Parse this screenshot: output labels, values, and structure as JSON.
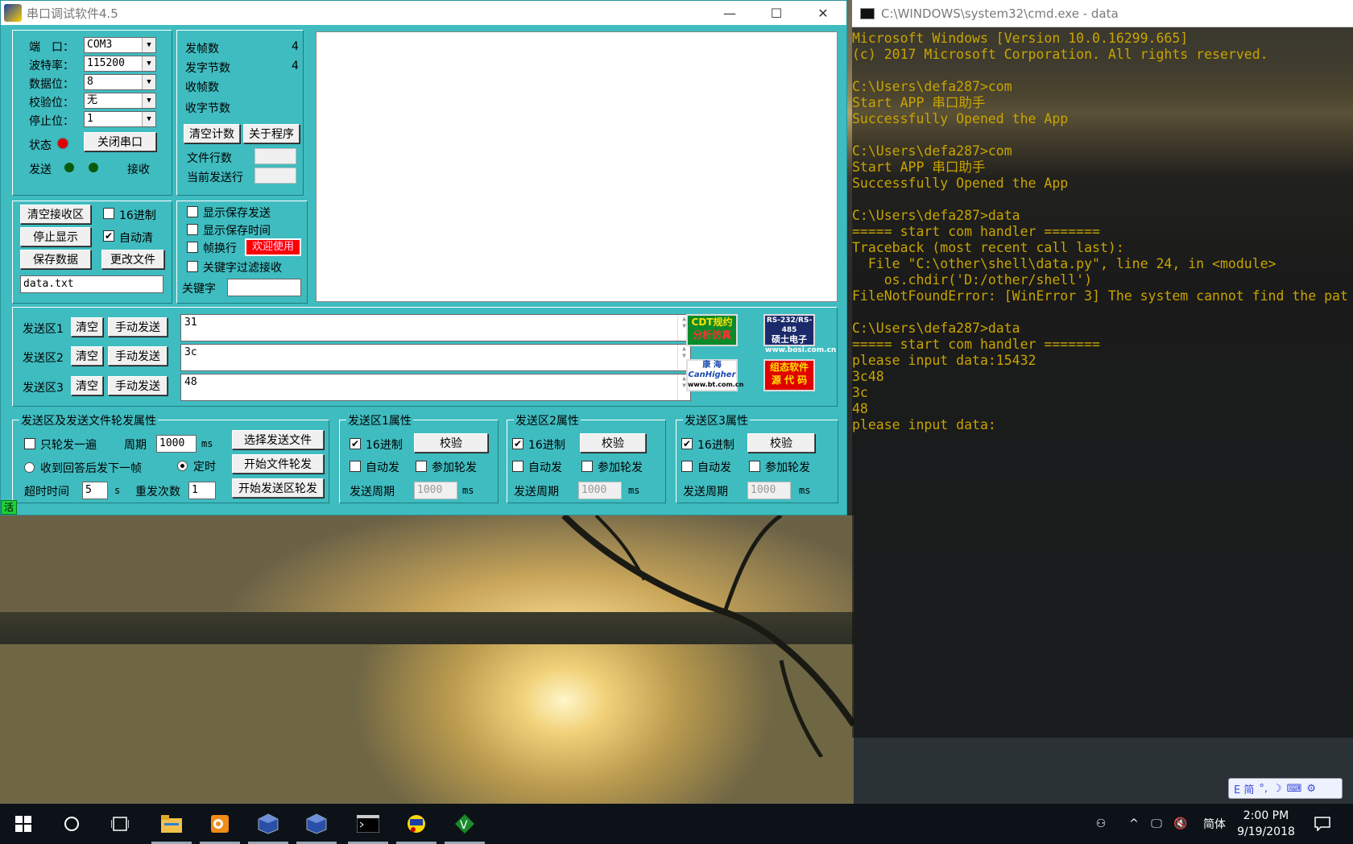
{
  "serial": {
    "title": "串口调试软件4.5",
    "port_labels": {
      "port": "端　口：",
      "baud": "波特率：",
      "databits": "数据位：",
      "parity": "校验位：",
      "stopbits": "停止位："
    },
    "port_values": {
      "port": "COM3",
      "baud": "115200",
      "databits": "8",
      "parity": "无",
      "stopbits": "1"
    },
    "status_label": "状态",
    "close_port_label": "关闭串口",
    "send_label": "发送",
    "recv_label": "接收",
    "counters": {
      "tx_frames_label": "发帧数",
      "tx_frames": "4",
      "tx_bytes_label": "发字节数",
      "tx_bytes": "4",
      "rx_frames_label": "收帧数",
      "rx_bytes_label": "收字节数"
    },
    "clear_count_label": "清空计数",
    "about_label": "关于程序",
    "file_lines_label": "文件行数",
    "current_line_label": "当前发送行",
    "rx_buttons": {
      "clear_rx": "清空接收区",
      "stop_display": "停止显示",
      "save_data": "保存数据",
      "change_file": "更改文件"
    },
    "hex16_label": "16进制",
    "auto_clear_label": "自动清",
    "filename": "data.txt",
    "options": {
      "show_save_send": "显示保存发送",
      "show_save_time": "显示保存时间",
      "frame_newline": "帧换行",
      "welcome": "欢迎使用",
      "keyword_filter": "关键字过滤接收",
      "keyword_label": "关键字"
    },
    "send_areas": [
      {
        "label": "发送区1",
        "clear": "清空",
        "manual": "手动发送",
        "value": "31"
      },
      {
        "label": "发送区2",
        "clear": "清空",
        "manual": "手动发送",
        "value": "3c"
      },
      {
        "label": "发送区3",
        "clear": "清空",
        "manual": "手动发送",
        "value": "48"
      }
    ],
    "logos": {
      "cdt_line1": "CDT规约",
      "cdt_line2": "分析仿真",
      "rs_line1": "RS-232/RS-485",
      "rs_line2": "硕士电子",
      "rs_line3": "www.bosi.com.cn",
      "kh_line1": "康 海",
      "kh_line2": "CanHigher",
      "kh_line3": "www.bt.com.cn",
      "zt_line1": "组态软件",
      "zt_line2": "源 代 码"
    },
    "rotation": {
      "group_title": "发送区及发送文件轮发属性",
      "once_label": "只轮发一遍",
      "period_label": "周期",
      "period_value": "1000",
      "ms": "ms",
      "on_reply_label": "收到回答后发下一帧",
      "timed_label": "定时",
      "timeout_label": "超时时间",
      "timeout_value": "5",
      "s": "s",
      "retry_label": "重发次数",
      "retry_value": "1",
      "select_file": "选择发送文件",
      "start_file_rotation": "开始文件轮发",
      "start_area_rotation": "开始发送区轮发"
    },
    "area_props": [
      {
        "title": "发送区1属性",
        "hex": "16进制",
        "verify": "校验",
        "auto": "自动发",
        "join": "参加轮发",
        "period_label": "发送周期",
        "period": "1000",
        "ms": "ms"
      },
      {
        "title": "发送区2属性",
        "hex": "16进制",
        "verify": "校验",
        "auto": "自动发",
        "join": "参加轮发",
        "period_label": "发送周期",
        "period": "1000",
        "ms": "ms"
      },
      {
        "title": "发送区3属性",
        "hex": "16进制",
        "verify": "校验",
        "auto": "自动发",
        "join": "参加轮发",
        "period_label": "发送周期",
        "period": "1000",
        "ms": "ms"
      }
    ],
    "active_tag": "活"
  },
  "cmd": {
    "title": "C:\\WINDOWS\\system32\\cmd.exe - data",
    "lines": [
      "Microsoft Windows [Version 10.0.16299.665]",
      "(c) 2017 Microsoft Corporation. All rights reserved.",
      "",
      "C:\\Users\\defa287>com",
      "Start APP 串口助手",
      "Successfully Opened the App",
      "",
      "C:\\Users\\defa287>com",
      "Start APP 串口助手",
      "Successfully Opened the App",
      "",
      "C:\\Users\\defa287>data",
      "===== start com handler =======",
      "Traceback (most recent call last):",
      "  File \"C:\\other\\shell\\data.py\", line 24, in <module>",
      "    os.chdir('D:/other/shell')",
      "FileNotFoundError: [WinError 3] The system cannot find the pat",
      "",
      "C:\\Users\\defa287>data",
      "===== start com handler =======",
      "please input data:15432",
      "3c48",
      "3c",
      "48",
      "please input data:"
    ]
  },
  "taskbar": {
    "lang": "简体",
    "time": "2:00 PM",
    "date": "9/19/2018"
  },
  "ime": {
    "label": "E 简"
  },
  "colors": {
    "app_bg": "#3fbcc0",
    "console_text": "#c9a400",
    "led_red": "#e00000",
    "led_green": "#0a5a0a",
    "welcome_bg": "#ff0000"
  }
}
